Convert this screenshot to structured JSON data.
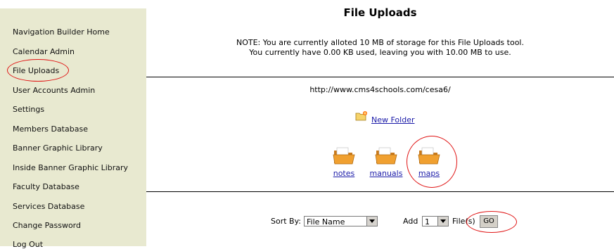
{
  "sidebar": {
    "items": [
      {
        "label": "Navigation Builder Home"
      },
      {
        "label": "Calendar Admin"
      },
      {
        "label": "File Uploads"
      },
      {
        "label": "User Accounts Admin"
      },
      {
        "label": "Settings"
      },
      {
        "label": "Members Database"
      },
      {
        "label": "Banner Graphic Library"
      },
      {
        "label": "Inside Banner Graphic Library"
      },
      {
        "label": "Faculty Database"
      },
      {
        "label": "Services Database"
      },
      {
        "label": "Change Password"
      },
      {
        "label": "Log Out"
      }
    ]
  },
  "main": {
    "title": "File Uploads",
    "note_line1": "NOTE: You are currently alloted 10 MB of storage for this File Uploads tool.",
    "note_line2": "You currently have 0.00 KB used, leaving you with 10.00 MB to use.",
    "url": "http://www.cms4schools.com/cesa6/",
    "new_folder": "New Folder",
    "folders": [
      {
        "label": "notes"
      },
      {
        "label": "manuals"
      },
      {
        "label": "maps"
      }
    ],
    "sort_label": "Sort By:",
    "sort_value": "File Name",
    "add_label": "Add",
    "add_value": "1",
    "files_label": "File(s)",
    "go_label": "GO"
  },
  "colors": {
    "sidebar_bg": "#e8e9d0",
    "highlight_oval": "#e01515",
    "link": "#1a1aa8",
    "folder": "#f0a030"
  }
}
